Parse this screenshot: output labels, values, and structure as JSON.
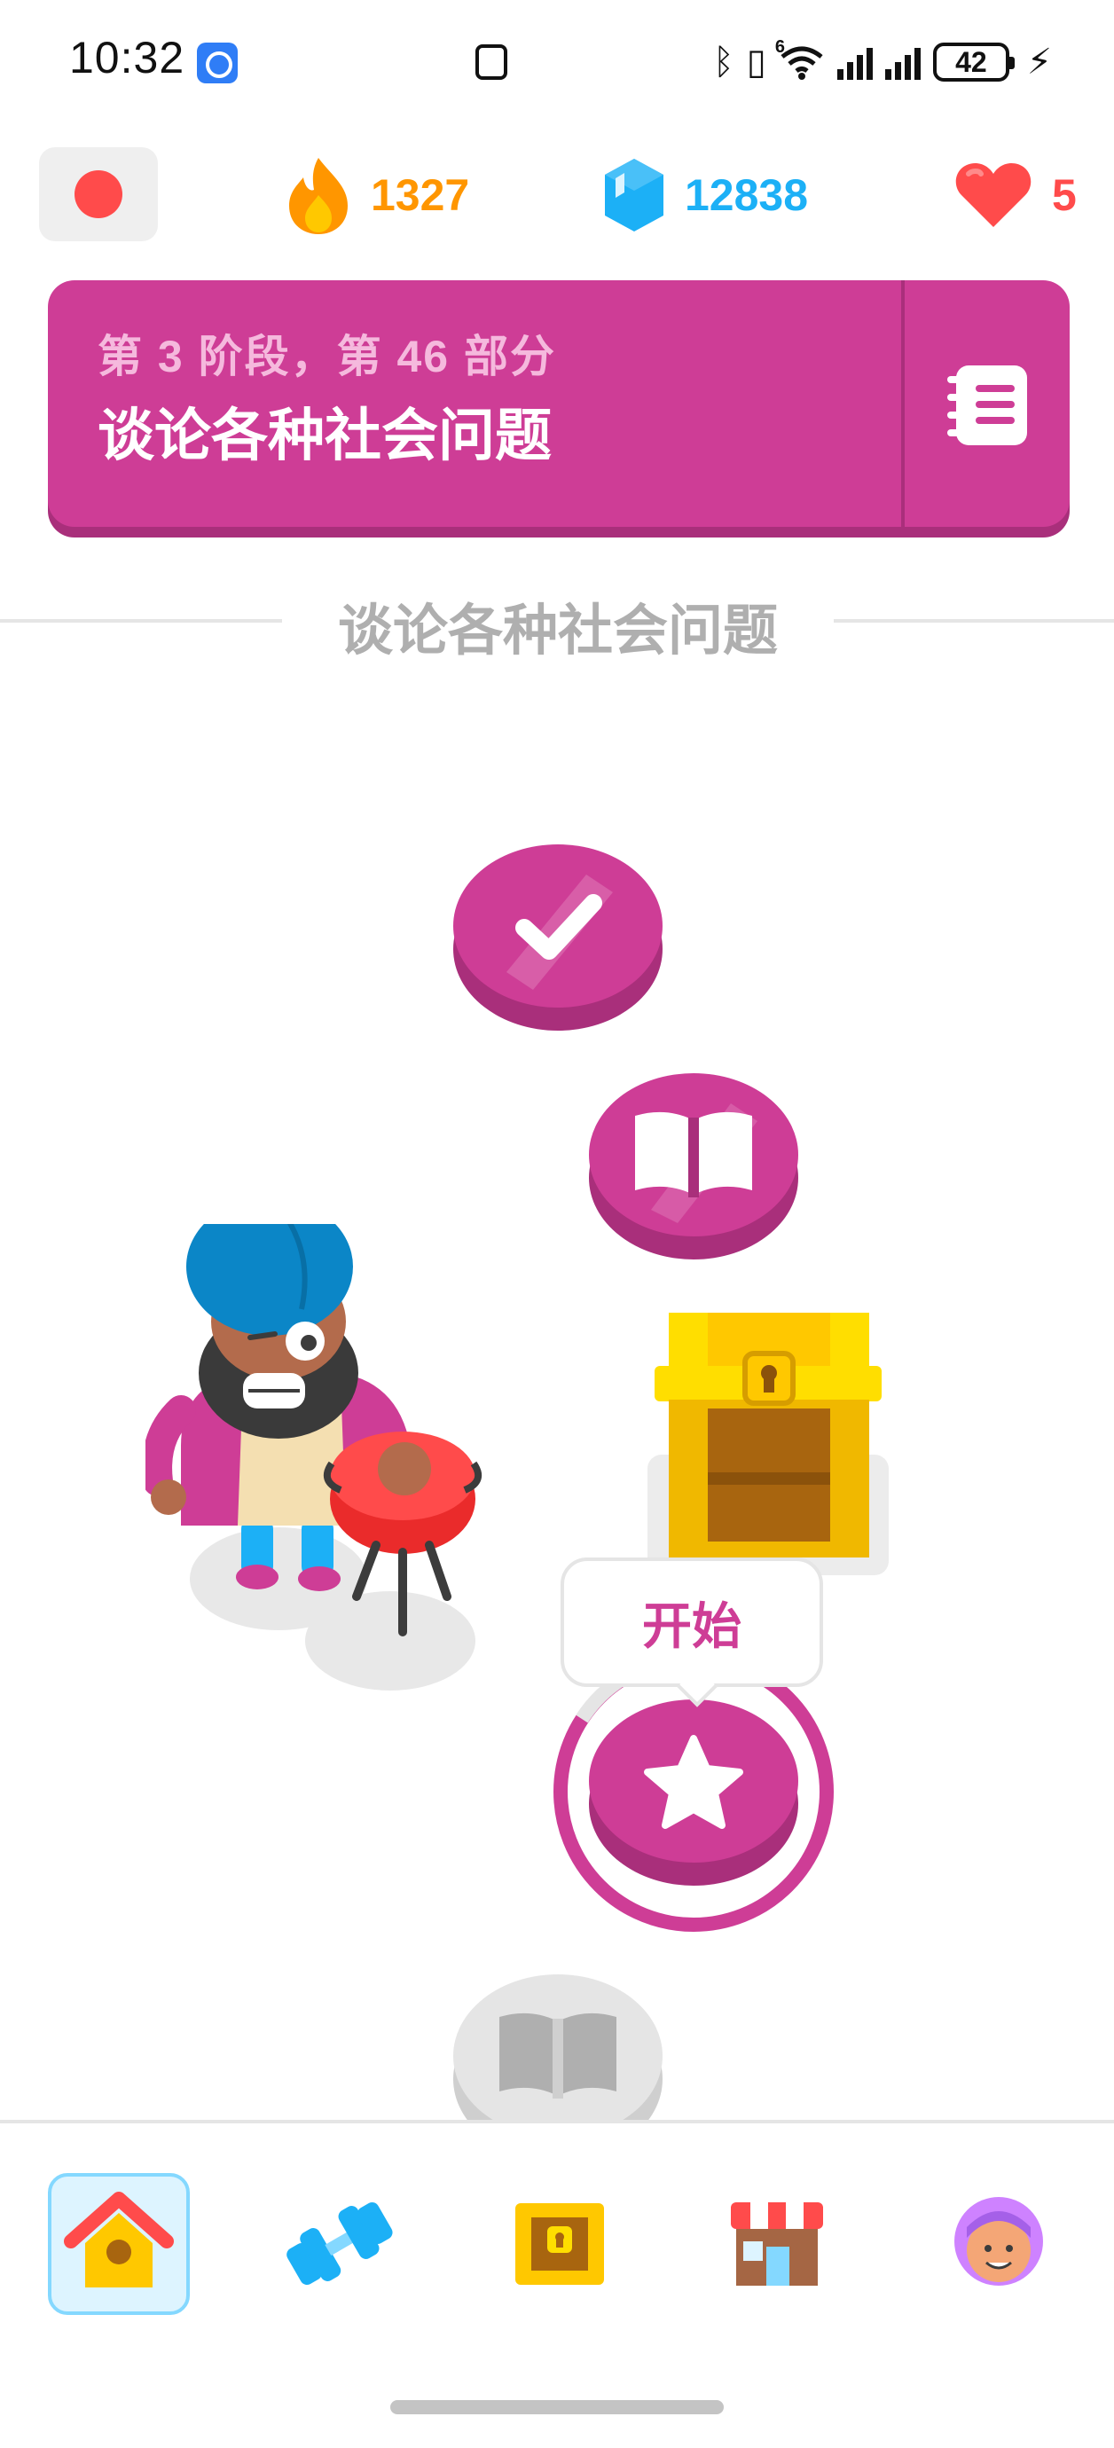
{
  "status_bar": {
    "time": "10:32",
    "network_label": "6",
    "battery": "42",
    "icons": [
      "screen-recorder-icon",
      "nfc-icon",
      "bluetooth-icon",
      "vibrate-icon",
      "wifi-icon",
      "signal-icon",
      "signal-icon",
      "battery-icon",
      "charging-icon"
    ]
  },
  "top_bar": {
    "course_flag": "japanese-flag-icon",
    "streak": "1327",
    "gems": "12838",
    "hearts": "5"
  },
  "unit": {
    "subtitle": "第 3 阶段，第 46 部分",
    "title": "谈论各种社会问题",
    "guide_icon": "guidebook-icon"
  },
  "section_title": "谈论各种社会问题",
  "path": {
    "nodes": [
      {
        "kind": "completed",
        "icon": "check-icon"
      },
      {
        "kind": "story",
        "icon": "book-icon"
      },
      {
        "kind": "chest",
        "icon": "treasure-chest-icon"
      },
      {
        "kind": "current",
        "icon": "star-icon",
        "tooltip": "开始"
      },
      {
        "kind": "locked",
        "icon": "book-icon"
      }
    ]
  },
  "bottom_nav": {
    "items": [
      {
        "name": "learn",
        "icon": "home-icon",
        "active": true
      },
      {
        "name": "practice",
        "icon": "dumbbell-icon",
        "active": false
      },
      {
        "name": "rewards",
        "icon": "treasure-chest-icon",
        "active": false
      },
      {
        "name": "shop",
        "icon": "shop-icon",
        "active": false
      },
      {
        "name": "profile",
        "icon": "avatar-icon",
        "active": false
      }
    ]
  },
  "colors": {
    "unit": "#ce3d96",
    "unit_shadow": "#a92f7b",
    "streak": "#ff9600",
    "gems": "#1cb0f6",
    "hearts": "#ff4b4b",
    "locked": "#e5e5e5"
  }
}
